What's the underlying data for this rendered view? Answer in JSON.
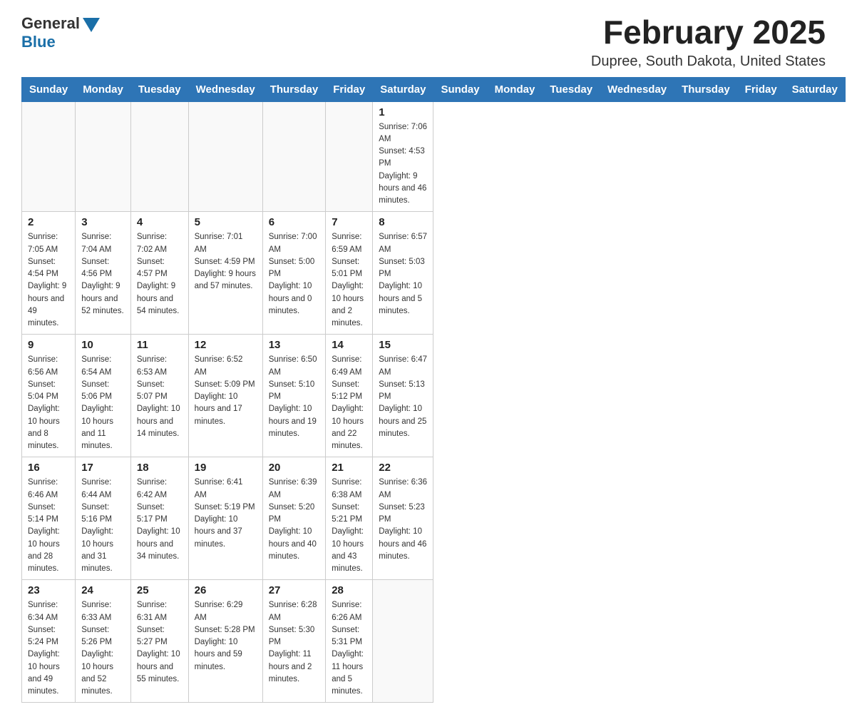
{
  "header": {
    "logo_general": "General",
    "logo_blue": "Blue",
    "month_title": "February 2025",
    "location": "Dupree, South Dakota, United States"
  },
  "days_of_week": [
    "Sunday",
    "Monday",
    "Tuesday",
    "Wednesday",
    "Thursday",
    "Friday",
    "Saturday"
  ],
  "weeks": [
    [
      {
        "day": "",
        "sunrise": "",
        "sunset": "",
        "daylight": ""
      },
      {
        "day": "",
        "sunrise": "",
        "sunset": "",
        "daylight": ""
      },
      {
        "day": "",
        "sunrise": "",
        "sunset": "",
        "daylight": ""
      },
      {
        "day": "",
        "sunrise": "",
        "sunset": "",
        "daylight": ""
      },
      {
        "day": "",
        "sunrise": "",
        "sunset": "",
        "daylight": ""
      },
      {
        "day": "",
        "sunrise": "",
        "sunset": "",
        "daylight": ""
      },
      {
        "day": "1",
        "sunrise": "Sunrise: 7:06 AM",
        "sunset": "Sunset: 4:53 PM",
        "daylight": "Daylight: 9 hours and 46 minutes."
      }
    ],
    [
      {
        "day": "2",
        "sunrise": "Sunrise: 7:05 AM",
        "sunset": "Sunset: 4:54 PM",
        "daylight": "Daylight: 9 hours and 49 minutes."
      },
      {
        "day": "3",
        "sunrise": "Sunrise: 7:04 AM",
        "sunset": "Sunset: 4:56 PM",
        "daylight": "Daylight: 9 hours and 52 minutes."
      },
      {
        "day": "4",
        "sunrise": "Sunrise: 7:02 AM",
        "sunset": "Sunset: 4:57 PM",
        "daylight": "Daylight: 9 hours and 54 minutes."
      },
      {
        "day": "5",
        "sunrise": "Sunrise: 7:01 AM",
        "sunset": "Sunset: 4:59 PM",
        "daylight": "Daylight: 9 hours and 57 minutes."
      },
      {
        "day": "6",
        "sunrise": "Sunrise: 7:00 AM",
        "sunset": "Sunset: 5:00 PM",
        "daylight": "Daylight: 10 hours and 0 minutes."
      },
      {
        "day": "7",
        "sunrise": "Sunrise: 6:59 AM",
        "sunset": "Sunset: 5:01 PM",
        "daylight": "Daylight: 10 hours and 2 minutes."
      },
      {
        "day": "8",
        "sunrise": "Sunrise: 6:57 AM",
        "sunset": "Sunset: 5:03 PM",
        "daylight": "Daylight: 10 hours and 5 minutes."
      }
    ],
    [
      {
        "day": "9",
        "sunrise": "Sunrise: 6:56 AM",
        "sunset": "Sunset: 5:04 PM",
        "daylight": "Daylight: 10 hours and 8 minutes."
      },
      {
        "day": "10",
        "sunrise": "Sunrise: 6:54 AM",
        "sunset": "Sunset: 5:06 PM",
        "daylight": "Daylight: 10 hours and 11 minutes."
      },
      {
        "day": "11",
        "sunrise": "Sunrise: 6:53 AM",
        "sunset": "Sunset: 5:07 PM",
        "daylight": "Daylight: 10 hours and 14 minutes."
      },
      {
        "day": "12",
        "sunrise": "Sunrise: 6:52 AM",
        "sunset": "Sunset: 5:09 PM",
        "daylight": "Daylight: 10 hours and 17 minutes."
      },
      {
        "day": "13",
        "sunrise": "Sunrise: 6:50 AM",
        "sunset": "Sunset: 5:10 PM",
        "daylight": "Daylight: 10 hours and 19 minutes."
      },
      {
        "day": "14",
        "sunrise": "Sunrise: 6:49 AM",
        "sunset": "Sunset: 5:12 PM",
        "daylight": "Daylight: 10 hours and 22 minutes."
      },
      {
        "day": "15",
        "sunrise": "Sunrise: 6:47 AM",
        "sunset": "Sunset: 5:13 PM",
        "daylight": "Daylight: 10 hours and 25 minutes."
      }
    ],
    [
      {
        "day": "16",
        "sunrise": "Sunrise: 6:46 AM",
        "sunset": "Sunset: 5:14 PM",
        "daylight": "Daylight: 10 hours and 28 minutes."
      },
      {
        "day": "17",
        "sunrise": "Sunrise: 6:44 AM",
        "sunset": "Sunset: 5:16 PM",
        "daylight": "Daylight: 10 hours and 31 minutes."
      },
      {
        "day": "18",
        "sunrise": "Sunrise: 6:42 AM",
        "sunset": "Sunset: 5:17 PM",
        "daylight": "Daylight: 10 hours and 34 minutes."
      },
      {
        "day": "19",
        "sunrise": "Sunrise: 6:41 AM",
        "sunset": "Sunset: 5:19 PM",
        "daylight": "Daylight: 10 hours and 37 minutes."
      },
      {
        "day": "20",
        "sunrise": "Sunrise: 6:39 AM",
        "sunset": "Sunset: 5:20 PM",
        "daylight": "Daylight: 10 hours and 40 minutes."
      },
      {
        "day": "21",
        "sunrise": "Sunrise: 6:38 AM",
        "sunset": "Sunset: 5:21 PM",
        "daylight": "Daylight: 10 hours and 43 minutes."
      },
      {
        "day": "22",
        "sunrise": "Sunrise: 6:36 AM",
        "sunset": "Sunset: 5:23 PM",
        "daylight": "Daylight: 10 hours and 46 minutes."
      }
    ],
    [
      {
        "day": "23",
        "sunrise": "Sunrise: 6:34 AM",
        "sunset": "Sunset: 5:24 PM",
        "daylight": "Daylight: 10 hours and 49 minutes."
      },
      {
        "day": "24",
        "sunrise": "Sunrise: 6:33 AM",
        "sunset": "Sunset: 5:26 PM",
        "daylight": "Daylight: 10 hours and 52 minutes."
      },
      {
        "day": "25",
        "sunrise": "Sunrise: 6:31 AM",
        "sunset": "Sunset: 5:27 PM",
        "daylight": "Daylight: 10 hours and 55 minutes."
      },
      {
        "day": "26",
        "sunrise": "Sunrise: 6:29 AM",
        "sunset": "Sunset: 5:28 PM",
        "daylight": "Daylight: 10 hours and 59 minutes."
      },
      {
        "day": "27",
        "sunrise": "Sunrise: 6:28 AM",
        "sunset": "Sunset: 5:30 PM",
        "daylight": "Daylight: 11 hours and 2 minutes."
      },
      {
        "day": "28",
        "sunrise": "Sunrise: 6:26 AM",
        "sunset": "Sunset: 5:31 PM",
        "daylight": "Daylight: 11 hours and 5 minutes."
      },
      {
        "day": "",
        "sunrise": "",
        "sunset": "",
        "daylight": ""
      }
    ]
  ]
}
